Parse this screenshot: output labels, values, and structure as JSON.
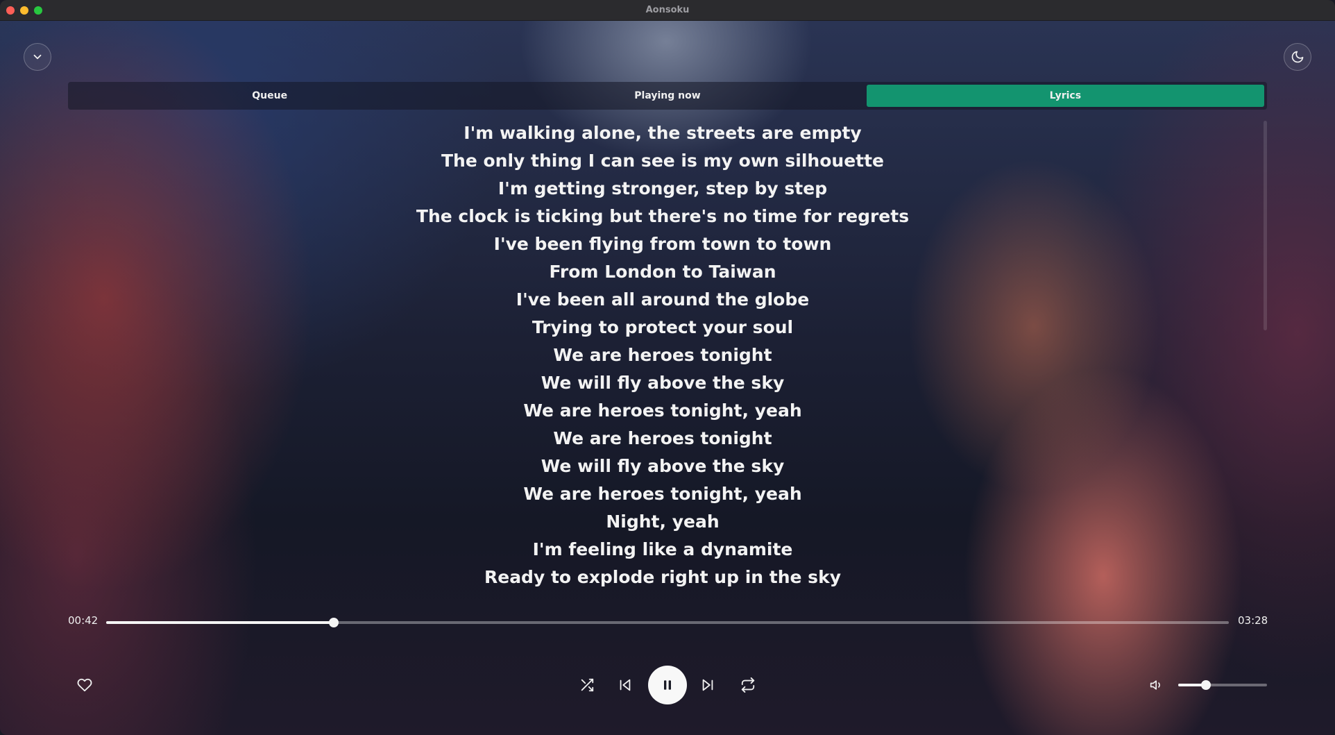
{
  "window": {
    "title": "Aonsoku"
  },
  "tabs": [
    {
      "label": "Queue"
    },
    {
      "label": "Playing now"
    },
    {
      "label": "Lyrics",
      "active": true
    }
  ],
  "lyrics": [
    "I'm walking alone, the streets are empty",
    "The only thing I can see is my own silhouette",
    "I'm getting stronger, step by step",
    "The clock is ticking but there's no time for regrets",
    "I've been flying from town to town",
    "From London to Taiwan",
    "I've been all around the globe",
    "Trying to protect your soul",
    "We are heroes tonight",
    "We will fly above the sky",
    "We are heroes tonight, yeah",
    "We are heroes tonight",
    "We will fly above the sky",
    "We are heroes tonight, yeah",
    "Night, yeah",
    "I'm feeling like a dynamite",
    "Ready to explode right up in the sky"
  ],
  "player": {
    "current_time": "00:42",
    "total_time": "03:28",
    "progress": 0.203,
    "volume": 0.31
  },
  "icons": {
    "collapse": "chevron-down-icon",
    "theme": "moon-icon",
    "favorite": "heart-icon",
    "shuffle": "shuffle-icon",
    "previous": "skip-back-icon",
    "play_pause": "pause-icon",
    "next": "skip-forward-icon",
    "repeat": "repeat-icon",
    "volume": "volume-icon"
  },
  "colors": {
    "accent": "#13946f",
    "traffic_close": "#ff5f57",
    "traffic_minimize": "#febc2e",
    "traffic_maximize": "#28c840"
  }
}
